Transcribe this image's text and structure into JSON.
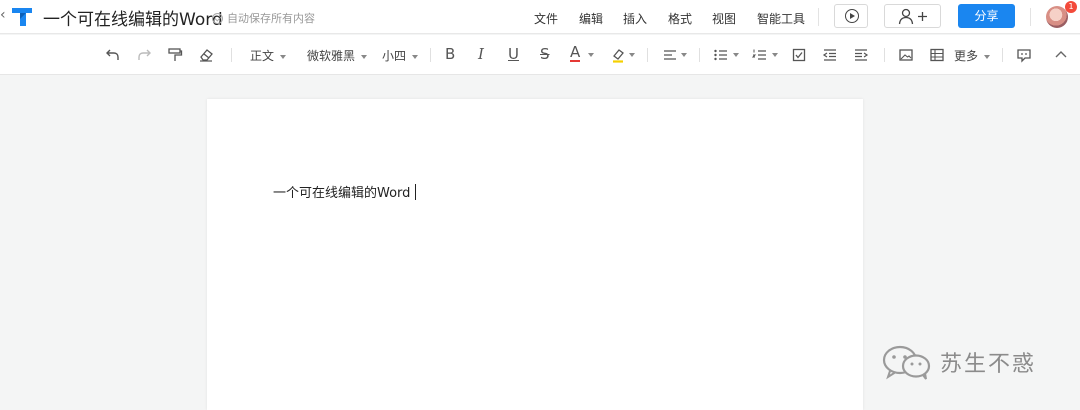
{
  "header": {
    "back_glyph": "‹",
    "title": "一个可在线编辑的Word",
    "autosave": "自动保存所有内容",
    "menu": [
      "文件",
      "编辑",
      "插入",
      "格式",
      "视图",
      "智能工具"
    ],
    "share_label": "分享",
    "notification_count": "1",
    "logo_color": "#1a86f0"
  },
  "toolbar": {
    "style_select": "正文",
    "font_select": "微软雅黑",
    "size_select": "小四",
    "bold": "B",
    "italic": "I",
    "underline": "U",
    "strike": "S",
    "font_color": "A",
    "font_color_hex": "#e53935",
    "highlight_hex": "#f5d000",
    "more_label": "更多"
  },
  "document": {
    "body_text": "一个可在线编辑的Word"
  },
  "watermark": {
    "text": "苏生不惑"
  }
}
